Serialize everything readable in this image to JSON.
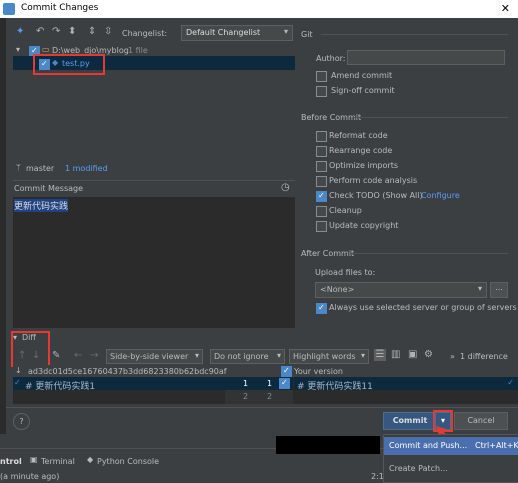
{
  "window": {
    "title": "Commit Changes",
    "close": "✕"
  },
  "toolbar": {
    "changelist_label": "Changelist:",
    "changelist_value": "Default Changelist"
  },
  "tree": {
    "folder": "D:\\web_djo\\myblog",
    "folder_count": "1 file",
    "file": "test.py"
  },
  "branch": {
    "name": "master",
    "status": "1 modified"
  },
  "commit_message": {
    "label": "Commit Message",
    "text": "更新代码实践"
  },
  "git": {
    "section": "Git",
    "author_label": "Author:",
    "author_value": "",
    "amend": "Amend commit",
    "signoff": "Sign-off commit"
  },
  "before_commit": {
    "section": "Before Commit",
    "items": [
      {
        "label": "Reformat code",
        "checked": false
      },
      {
        "label": "Rearrange code",
        "checked": false
      },
      {
        "label": "Optimize imports",
        "checked": false
      },
      {
        "label": "Perform code analysis",
        "checked": false
      },
      {
        "label": "Check TODO (Show All)",
        "checked": true,
        "link": "Configure"
      },
      {
        "label": "Cleanup",
        "checked": false
      },
      {
        "label": "Update copyright",
        "checked": false
      }
    ]
  },
  "after_commit": {
    "section": "After Commit",
    "upload_label": "Upload files to:",
    "upload_value": "<None>",
    "browse": "...",
    "always_use": "Always use selected server or group of servers"
  },
  "diff": {
    "label": "Diff",
    "viewer": "Side-by-side viewer",
    "ignore": "Do not ignore",
    "highlight": "Highlight words",
    "difference_count": "1 difference",
    "left_hash": "ad3dc01d5ce16760437b3dd6823380b62bdc90af",
    "right_title": "Your version",
    "left_line1": "# 更新代码实践1",
    "right_line1": "# 更新代码实践11",
    "ln_l1": "1",
    "ln_r1": "1",
    "ln_l2": "2",
    "ln_r2": "2"
  },
  "buttons": {
    "help": "?",
    "commit": "Commit",
    "cancel": "Cancel"
  },
  "commit_menu": {
    "items": [
      {
        "label": "Commit and Push...",
        "shortcut": "Ctrl+Alt+K"
      },
      {
        "label": "Create Patch...",
        "shortcut": ""
      }
    ]
  },
  "bottom_tabs": {
    "tab1": "ntrol",
    "tab2": "Terminal",
    "tab3": "Python Console",
    "status": "(a minute ago)",
    "pos": "2:1"
  },
  "colors": {
    "accent": "#4a88c7",
    "selection": "#0d293e",
    "highlight_red": "#e53935",
    "background": "#3c3f41"
  }
}
